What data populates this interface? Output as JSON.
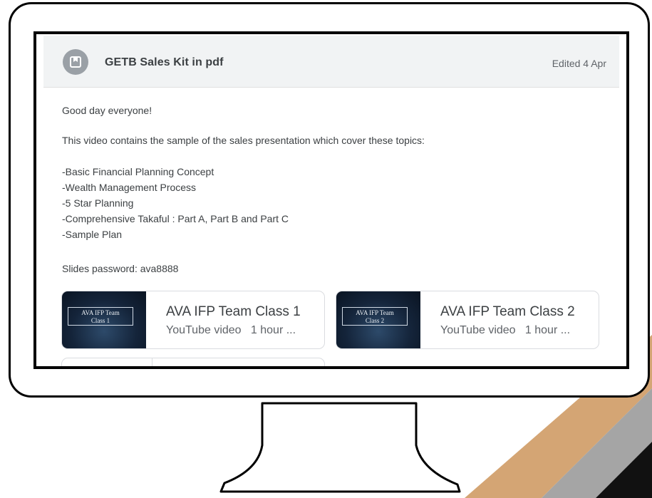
{
  "post": {
    "title": "GETB Sales Kit in pdf",
    "edited": "Edited 4 Apr",
    "greeting": "Good day everyone!",
    "intro": "This video contains the sample of the sales presentation which cover these topics:",
    "topics": [
      "-Basic Financial Planning Concept",
      "-Wealth Management Process",
      "-5 Star Planning",
      "-Comprehensive Takaful : Part A, Part B and Part C",
      "-Sample Plan"
    ],
    "password_line": "Slides password: ava8888"
  },
  "attachments": [
    {
      "thumb_text": "AVA IFP Team\nClass 1",
      "title": "AVA IFP Team Class 1",
      "subtitle": "YouTube video   1 hour ..."
    },
    {
      "thumb_text": "AVA IFP Team\nClass 2",
      "title": "AVA IFP Team Class 2",
      "subtitle": "YouTube video   1 hour ..."
    }
  ],
  "icons": {
    "avatar": "bookmark-icon"
  },
  "colors": {
    "stripe_tan": "#d4a574",
    "stripe_gray": "#a0a0a0",
    "stripe_black": "#111111"
  }
}
